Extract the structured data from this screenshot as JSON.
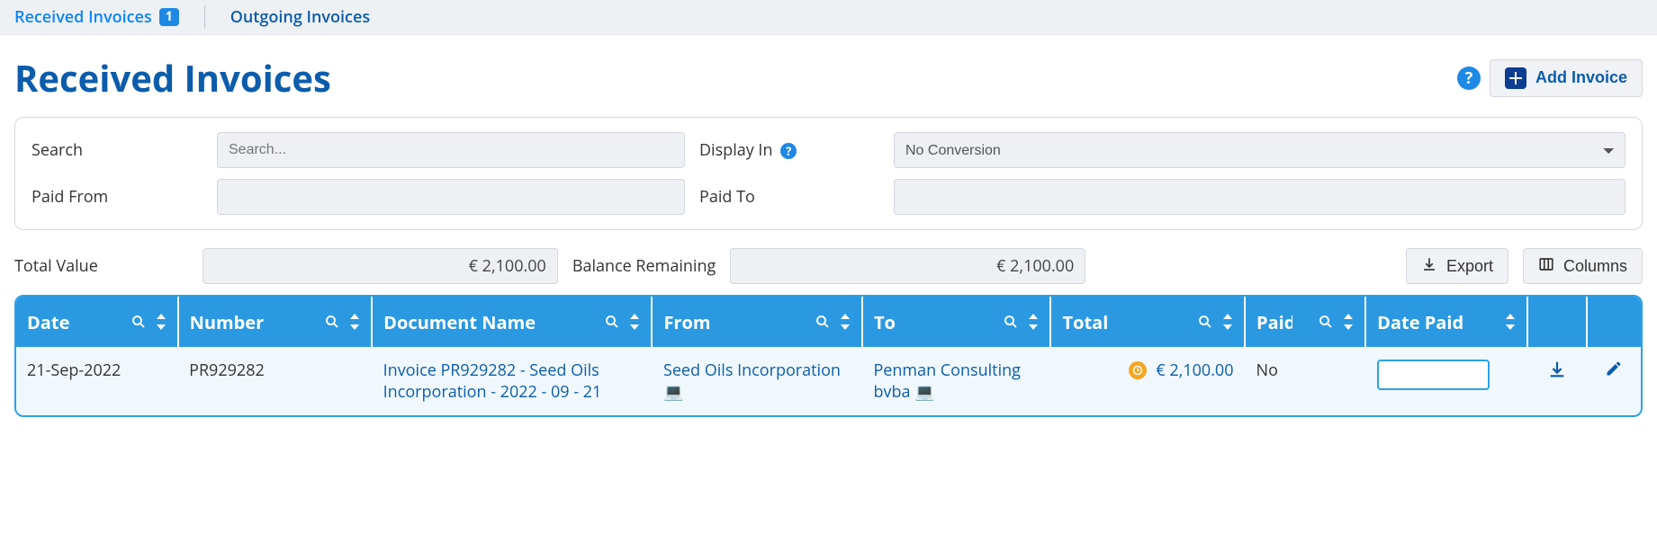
{
  "tabs": {
    "received_label": "Received Invoices",
    "received_badge": "1",
    "outgoing_label": "Outgoing Invoices"
  },
  "header": {
    "title": "Received Invoices",
    "add_button": "Add Invoice"
  },
  "filters": {
    "search_label": "Search",
    "search_placeholder": "Search...",
    "display_in_label": "Display In",
    "display_in_selected": "No Conversion",
    "paid_from_label": "Paid From",
    "paid_to_label": "Paid To"
  },
  "summary": {
    "total_value_label": "Total Value",
    "total_value": "€ 2,100.00",
    "balance_remaining_label": "Balance Remaining",
    "balance_remaining": "€ 2,100.00",
    "export_label": "Export",
    "columns_label": "Columns"
  },
  "table": {
    "headers": {
      "date": "Date",
      "number": "Number",
      "document_name": "Document Name",
      "from": "From",
      "to": "To",
      "total": "Total",
      "paid": "Paid",
      "date_paid": "Date Paid"
    },
    "rows": [
      {
        "date": "21-Sep-2022",
        "number": "PR929282",
        "doc": "Invoice PR929282 - Seed Oils Incorporation - 2022 - 09 - 21",
        "from": "Seed Oils Incorporation",
        "to": "Penman Consulting bvba",
        "total": "€ 2,100.00",
        "paid": "No",
        "date_paid": ""
      }
    ]
  }
}
